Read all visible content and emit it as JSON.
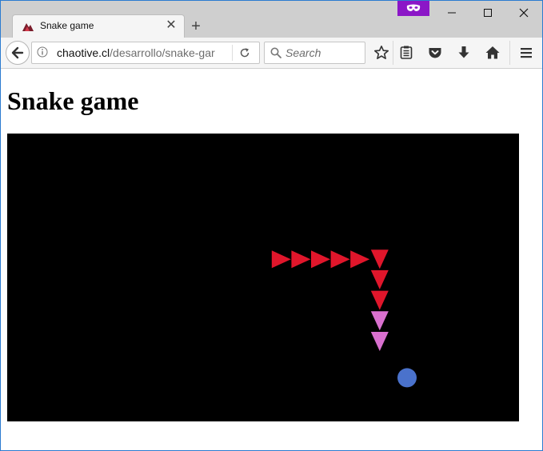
{
  "browser": {
    "tab": {
      "title": "Snake game"
    },
    "newtab_label": "+",
    "address": {
      "host": "chaotive.cl",
      "path": "/desarrollo/snake-gar"
    },
    "search": {
      "placeholder": "Search"
    },
    "window_controls": {
      "minimize": "—",
      "maximize": "☐",
      "close": "✕"
    },
    "tab_close": "✕"
  },
  "icons": {
    "private": "mask-icon",
    "back": "arrow-left-icon",
    "info": "info-icon",
    "reload": "reload-icon",
    "search": "search-icon",
    "bookmark": "star-icon",
    "reader": "reading-list-icon",
    "pocket": "pocket-icon",
    "download": "download-icon",
    "home": "home-icon",
    "menu": "hamburger-menu-icon"
  },
  "page": {
    "heading": "Snake game"
  },
  "game": {
    "grid": {
      "columns": 26,
      "rows": 14
    },
    "food": {
      "cell": [
        20,
        12
      ],
      "color": "#4a72cc"
    },
    "snake": [
      {
        "cell": [
          13,
          6
        ],
        "direction": "right",
        "color": "#e0162b"
      },
      {
        "cell": [
          14,
          6
        ],
        "direction": "right",
        "color": "#e0162b"
      },
      {
        "cell": [
          15,
          6
        ],
        "direction": "right",
        "color": "#e0162b"
      },
      {
        "cell": [
          16,
          6
        ],
        "direction": "right",
        "color": "#e0162b"
      },
      {
        "cell": [
          17,
          6
        ],
        "direction": "right",
        "color": "#e0162b"
      },
      {
        "cell": [
          18,
          6
        ],
        "direction": "down",
        "color": "#e0162b"
      },
      {
        "cell": [
          18,
          7
        ],
        "direction": "down",
        "color": "#e0162b"
      },
      {
        "cell": [
          18,
          8
        ],
        "direction": "down",
        "color": "#e0162b"
      },
      {
        "cell": [
          18,
          9
        ],
        "direction": "down",
        "color": "#d970cf"
      },
      {
        "cell": [
          18,
          10
        ],
        "direction": "down",
        "color": "#d970cf"
      }
    ]
  },
  "colors": {
    "private_badge": "#8b17c7",
    "canvas_bg": "#000000"
  }
}
